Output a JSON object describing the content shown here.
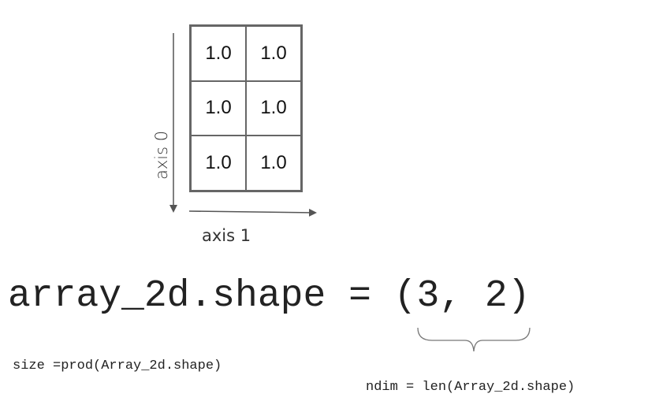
{
  "array": {
    "cells": [
      [
        "1.0",
        "1.0"
      ],
      [
        "1.0",
        "1.0"
      ],
      [
        "1.0",
        "1.0"
      ]
    ]
  },
  "axis0_label": "axis 0",
  "axis1_label": "axis 1",
  "shape_expression": "array_2d.shape = (3, 2)",
  "size_expression": "size =prod(Array_2d.shape)",
  "ndim_expression": "ndim = len(Array_2d.shape)"
}
